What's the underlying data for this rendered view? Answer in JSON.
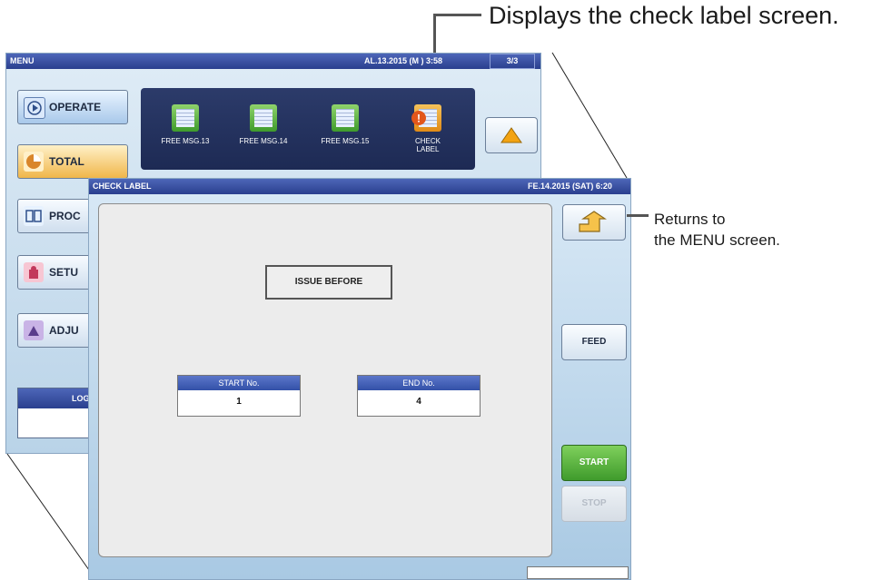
{
  "callouts": {
    "check_label": "Displays the check label screen.",
    "returns_line1": "Returns to",
    "returns_line2": "the MENU screen."
  },
  "menu_screen": {
    "title": "MENU",
    "datetime": "AL.13.2015 (M   ) 3:58",
    "page": "3/3",
    "buttons": [
      {
        "label": "OPERATE"
      },
      {
        "label": "TOTAL"
      },
      {
        "label": "PROC"
      },
      {
        "label": "SETU"
      },
      {
        "label": "ADJU"
      }
    ],
    "items": [
      {
        "label": "FREE MSG.13"
      },
      {
        "label": "FREE MSG.14"
      },
      {
        "label": "FREE MSG.15"
      },
      {
        "label": "CHECK LABEL"
      }
    ],
    "login_label": "LOGI"
  },
  "check_screen": {
    "title": "CHECK LABEL",
    "datetime": "FE.14.2015 (SAT)  6:20",
    "status": "ISSUE BEFORE",
    "start_no": {
      "label": "START No.",
      "value": "1"
    },
    "end_no": {
      "label": "END No.",
      "value": "4"
    },
    "buttons": {
      "feed": "FEED",
      "start": "START",
      "stop": "STOP"
    }
  },
  "colors": {
    "titlebar": "#2a3f8e",
    "start_button": "#3f9b2c",
    "check_label_icon": "#f08a1c"
  }
}
